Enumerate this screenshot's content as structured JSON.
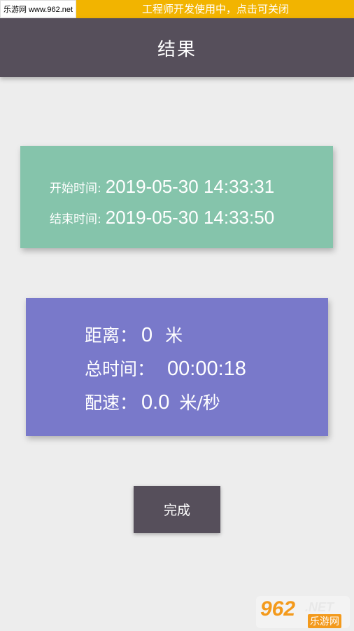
{
  "status_bar": {
    "site_watermark": "乐游网 www.962.net",
    "dev_notice": "工程师开发使用中，点击可关闭"
  },
  "app_bar": {
    "title": "结果"
  },
  "time_card": {
    "start_label": "开始时间:",
    "start_value": "2019-05-30 14:33:31",
    "end_label": "结束时间:",
    "end_value": "2019-05-30 14:33:50"
  },
  "stats_card": {
    "distance_label": "距离：",
    "distance_value": "0",
    "distance_unit": "米",
    "total_time_label": "总时间：",
    "total_time_value": "00:00:18",
    "pace_label": "配速：",
    "pace_value": "0.0",
    "pace_unit": "米/秒"
  },
  "done_button": {
    "label": "完成"
  },
  "watermark_logo": {
    "number": "962",
    "tld": ".NET",
    "cn_name": "乐游网"
  },
  "colors": {
    "status_bar": "#f2b400",
    "app_bar": "#564f5b",
    "time_card": "#85c4ab",
    "stats_card": "#7979ca",
    "background": "#ededed"
  }
}
